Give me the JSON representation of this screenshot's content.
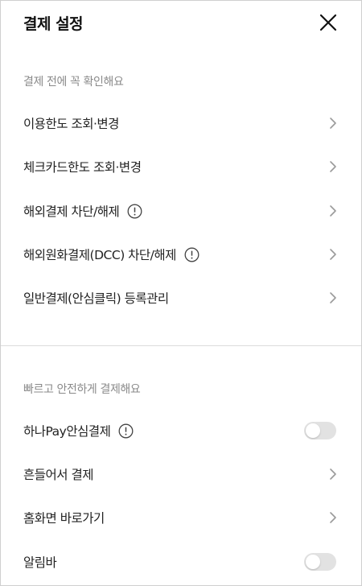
{
  "header": {
    "title": "결제 설정",
    "close_icon": "close-icon"
  },
  "section1": {
    "label": "결제 전에 꼭 확인해요",
    "items": [
      {
        "label": "이용한도 조회·변경",
        "info": false,
        "control": "chevron"
      },
      {
        "label": "체크카드한도 조회·변경",
        "info": false,
        "control": "chevron"
      },
      {
        "label": "해외결제 차단/해제",
        "info": true,
        "control": "chevron"
      },
      {
        "label": "해외원화결제(DCC) 차단/해제",
        "info": true,
        "control": "chevron"
      },
      {
        "label": "일반결제(안심클릭) 등록관리",
        "info": false,
        "control": "chevron"
      }
    ]
  },
  "section2": {
    "label": "빠르고 안전하게 결제해요",
    "items": [
      {
        "label": "하나Pay안심결제",
        "info": true,
        "control": "toggle",
        "toggle_on": false
      },
      {
        "label": "흔들어서 결제",
        "info": false,
        "control": "chevron"
      },
      {
        "label": "홈화면 바로가기",
        "info": false,
        "control": "chevron"
      },
      {
        "label": "알림바",
        "info": false,
        "control": "toggle",
        "toggle_on": false
      }
    ]
  },
  "colors": {
    "text": "#222222",
    "section_label": "#8a8a8a",
    "toggle_off_track": "#e2e2e2",
    "chevron": "#9a9a9a"
  }
}
